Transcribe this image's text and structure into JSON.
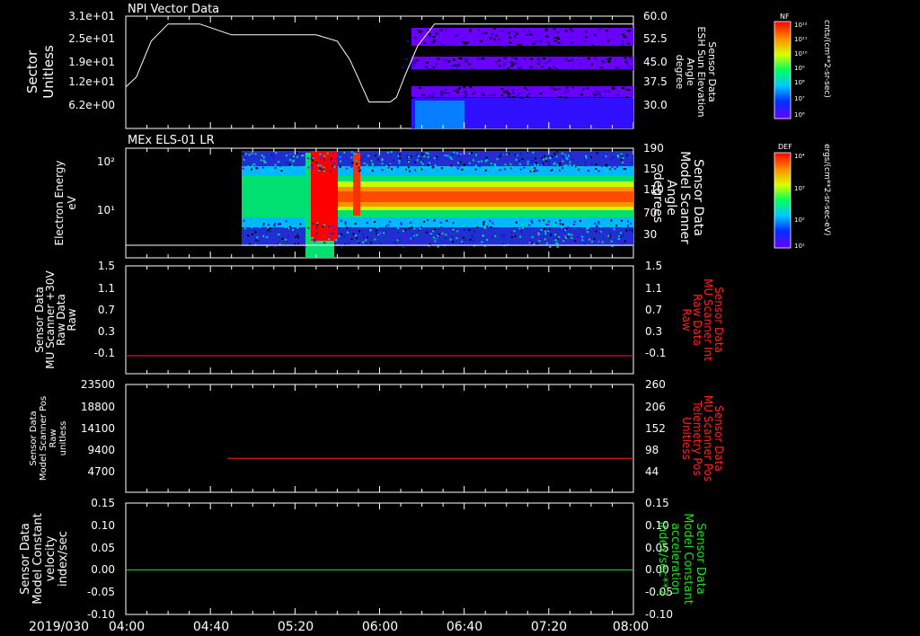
{
  "date_label": "2019/030",
  "time_axis": {
    "ticks": [
      "04:00",
      "04:40",
      "05:20",
      "06:00",
      "06:40",
      "07:20",
      "08:00"
    ]
  },
  "colorbars": [
    {
      "tag": "NF",
      "unit": "cnts/(cm**2-sr-sec)",
      "labels": [
        "10¹²",
        "10¹¹",
        "10¹⁰",
        "10⁹",
        "10⁸",
        "10⁷",
        "10⁶"
      ]
    },
    {
      "tag": "DEF",
      "unit": "ergs/(cm**2-sr-sec-eV)",
      "labels": [
        "10⁴",
        "10³",
        "10²",
        "10¹"
      ]
    }
  ],
  "colors": {
    "series_red": "#ff2020",
    "series_green": "#22dd22",
    "curve_white": "#ffffff",
    "frame": "#ffffff"
  },
  "chart_data": [
    {
      "type": "heatmap",
      "title": "NPI Vector Data",
      "ylabel": [
        "Sector",
        "Unitless"
      ],
      "yticks": [
        "3.1e+01",
        "2.5e+01",
        "1.9e+01",
        "1.2e+01",
        "6.2e+00"
      ],
      "right_label": [
        "Sensor Data",
        "ESH Sun Elevation",
        "Angle",
        "degree"
      ],
      "right_ticks": [
        "60.0",
        "52.5",
        "45.0",
        "37.5",
        "30.0"
      ],
      "right_ylim": [
        24.0,
        60.0
      ],
      "heatmap_start": "06:10",
      "elevation_curve": {
        "name": "ESH Sun Elevation Angle",
        "x": [
          "04:00",
          "04:05",
          "04:12",
          "04:20",
          "04:35",
          "04:50",
          "05:10",
          "05:30",
          "05:40",
          "05:46",
          "05:52",
          "05:55",
          "06:05",
          "06:08",
          "06:12",
          "06:18",
          "06:26",
          "06:32",
          "08:00"
        ],
        "y": [
          37.3,
          40.5,
          52.0,
          57.5,
          57.5,
          54.0,
          54.0,
          54.0,
          52.0,
          46.0,
          37.0,
          32.5,
          32.5,
          34.0,
          41.0,
          50.5,
          57.5,
          57.5,
          57.5
        ]
      }
    },
    {
      "type": "heatmap",
      "title": "MEx ELS-01 LR",
      "ylabel": [
        "Electron Energy",
        "eV"
      ],
      "yticks": [
        "10²",
        "10¹"
      ],
      "ylim_log": [
        0.3,
        2.2
      ],
      "right_label": [
        "Sensor Data",
        "Model Scanner",
        "Angle",
        "degrees"
      ],
      "right_ticks": [
        "190",
        "150",
        "110",
        "70",
        "30"
      ],
      "right_ylim": [
        0,
        190
      ],
      "data_start": "04:55",
      "enhancement": {
        "start": "05:22",
        "end": "05:34",
        "secondary": "05:42"
      },
      "threshold_line": {
        "color": "#ffffff",
        "y": 0.39
      }
    },
    {
      "type": "line",
      "ylabel": [
        "Sensor Data",
        "MU Scanner +30V",
        "Raw Data",
        "Raw"
      ],
      "yticks": [
        "1.5",
        "1.1",
        "0.7",
        "0.3",
        "-0.1"
      ],
      "ylim": [
        -0.3,
        1.5
      ],
      "right_label": [
        "Sensor Data",
        "MU Scanner Int",
        "Raw Data",
        "Raw"
      ],
      "right_ticks": [
        "1.5",
        "1.1",
        "0.7",
        "0.3",
        "-0.1"
      ],
      "series": [
        {
          "x": [
            "04:00",
            "08:00"
          ],
          "y": [
            0.0,
            0.0
          ]
        }
      ]
    },
    {
      "type": "line",
      "ylabel": [
        "Sensor Data",
        "Model Scanner Pos",
        "Raw",
        "unitless"
      ],
      "yticks": [
        "23500",
        "18800",
        "14100",
        "9400",
        "4700"
      ],
      "ylim": [
        0,
        23500
      ],
      "right_label": [
        "Sensor Data",
        "MU Scanner Pos",
        "Telemetry Pos",
        "Unitless"
      ],
      "right_ticks": [
        "260",
        "206",
        "152",
        "98",
        "44"
      ],
      "series": [
        {
          "x": [
            "04:48",
            "08:00"
          ],
          "y": [
            7400,
            7400
          ]
        }
      ]
    },
    {
      "type": "line",
      "ylabel": [
        "Sensor Data",
        "Model Constant",
        "velocity",
        "index/sec"
      ],
      "yticks": [
        "0.15",
        "0.10",
        "0.05",
        "0.00",
        "-0.05",
        "-0.10"
      ],
      "ylim": [
        -0.1,
        0.15
      ],
      "right_label": [
        "Sensor Data",
        "Model Constant",
        "acceleration",
        "index/sec**2"
      ],
      "right_ticks": [
        "0.15",
        "0.10",
        "0.05",
        "0.00",
        "-0.05",
        "-0.10"
      ],
      "series": [
        {
          "x": [
            "04:00",
            "08:00"
          ],
          "y": [
            0.0,
            0.0
          ]
        }
      ]
    }
  ]
}
